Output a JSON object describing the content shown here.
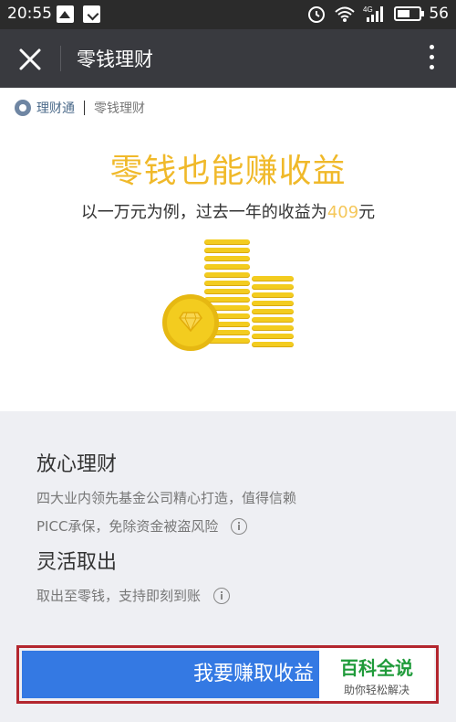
{
  "status_bar": {
    "time": "20:55",
    "network": "4G",
    "battery_percent": "56",
    "battery_level": 0.56
  },
  "nav": {
    "title": "零钱理财",
    "close_icon": "close-icon",
    "more_icon": "more-vertical-icon"
  },
  "brand": {
    "name": "理财通",
    "subtitle": "零钱理财"
  },
  "hero": {
    "title": "零钱也能赚收益",
    "subtitle_prefix": "以一万元为例，过去一年的收益为",
    "amount": "409",
    "subtitle_suffix": "元",
    "colors": {
      "title": "#f0b92a",
      "amount": "#f5c75a",
      "coin": "#f3cc1f"
    }
  },
  "features": [
    {
      "title": "放心理财",
      "lines": [
        "四大业内领先基金公司精心打造，值得信赖",
        "PICC承保，免除资金被盗风险"
      ]
    },
    {
      "title": "灵活取出",
      "lines": [
        "取出至零钱，支持即刻到账"
      ]
    }
  ],
  "cta": {
    "label": "我要赚取收益",
    "color": "#3479e3"
  },
  "watermark": {
    "title": "百科全说",
    "subtitle": "助你轻松解决"
  }
}
